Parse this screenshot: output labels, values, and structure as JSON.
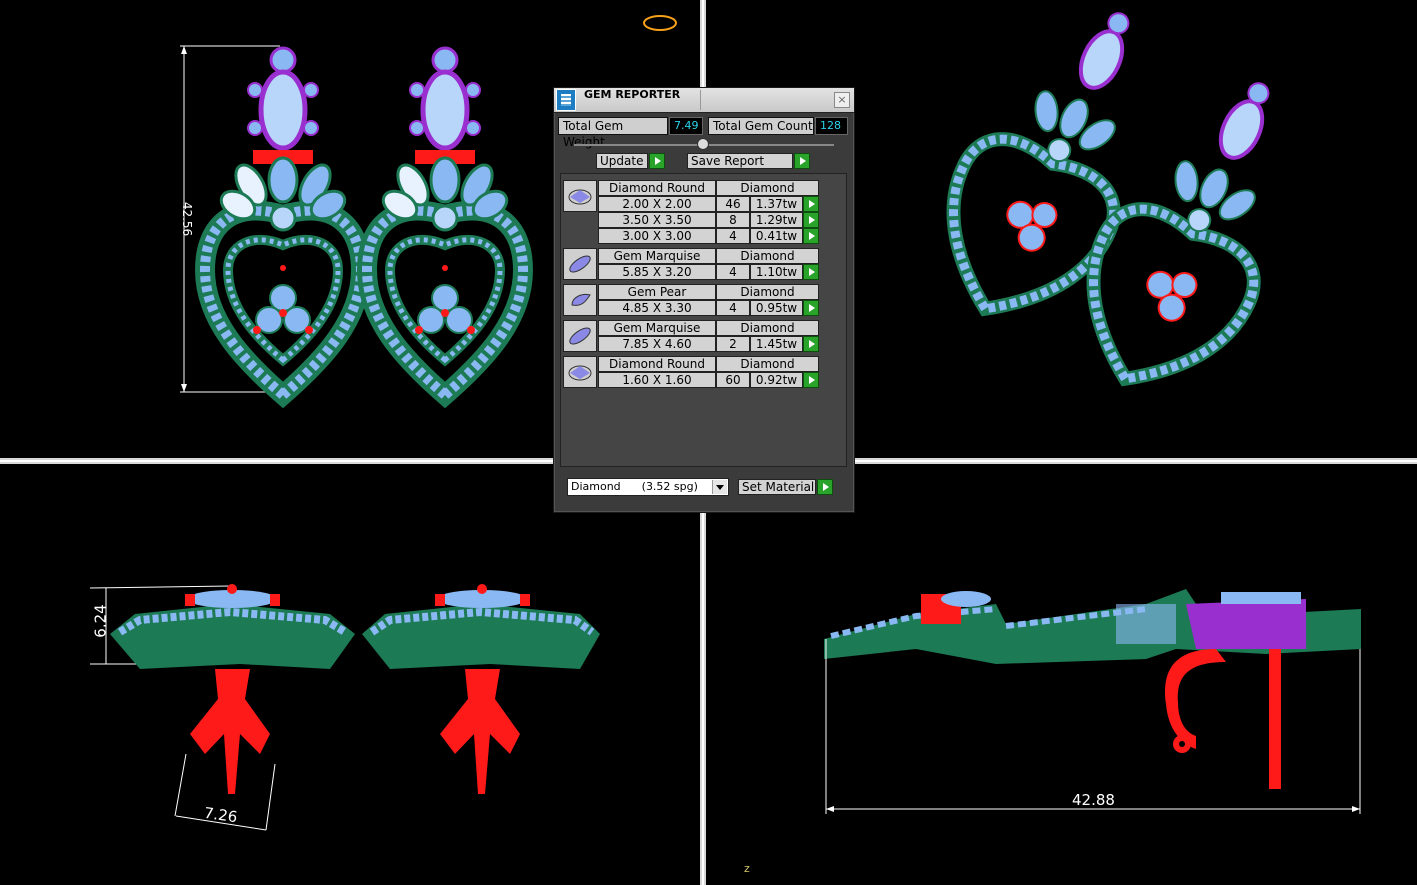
{
  "dimensions": {
    "front_height": "42.56",
    "side_height": "6.24",
    "side_width": "7.26",
    "side_length": "42.88"
  },
  "axis_label": "z",
  "dialog": {
    "title": "GEM REPORTER",
    "close_icon": "close-icon",
    "total_weight_label": "Total Gem Weight",
    "total_weight_value": "7.49",
    "total_count_label": "Total Gem Count",
    "total_count_value": "128",
    "update_label": "Update",
    "save_report_label": "Save Report",
    "groups": [
      {
        "shape": "Diamond Round",
        "material": "Diamond",
        "icon": "round-gem-icon",
        "rows": [
          {
            "size": "2.00 X 2.00",
            "count": "46",
            "weight": "1.37tw"
          },
          {
            "size": "3.50 X 3.50",
            "count": "8",
            "weight": "1.29tw"
          },
          {
            "size": "3.00 X 3.00",
            "count": "4",
            "weight": "0.41tw"
          }
        ]
      },
      {
        "shape": "Gem Marquise",
        "material": "Diamond",
        "icon": "marquise-gem-icon",
        "rows": [
          {
            "size": "5.85 X 3.20",
            "count": "4",
            "weight": "1.10tw"
          }
        ]
      },
      {
        "shape": "Gem Pear",
        "material": "Diamond",
        "icon": "pear-gem-icon",
        "rows": [
          {
            "size": "4.85 X 3.30",
            "count": "4",
            "weight": "0.95tw"
          }
        ]
      },
      {
        "shape": "Gem Marquise",
        "material": "Diamond",
        "icon": "marquise-gem-icon",
        "rows": [
          {
            "size": "7.85 X 4.60",
            "count": "2",
            "weight": "1.45tw"
          }
        ]
      },
      {
        "shape": "Diamond Round",
        "material": "Diamond",
        "icon": "round-gem-icon",
        "rows": [
          {
            "size": "1.60 X 1.60",
            "count": "60",
            "weight": "0.92tw"
          }
        ]
      }
    ],
    "material_select_value": "Diamond      (3.52 spg)",
    "set_material_label": "Set Material"
  },
  "colors": {
    "gem": "#8ab8f2",
    "metal_green": "#1c7a55",
    "red": "#ff1a1a",
    "purple": "#9a2fd0",
    "value_text": "#2ad4ea",
    "go_button": "#2aa32a"
  }
}
